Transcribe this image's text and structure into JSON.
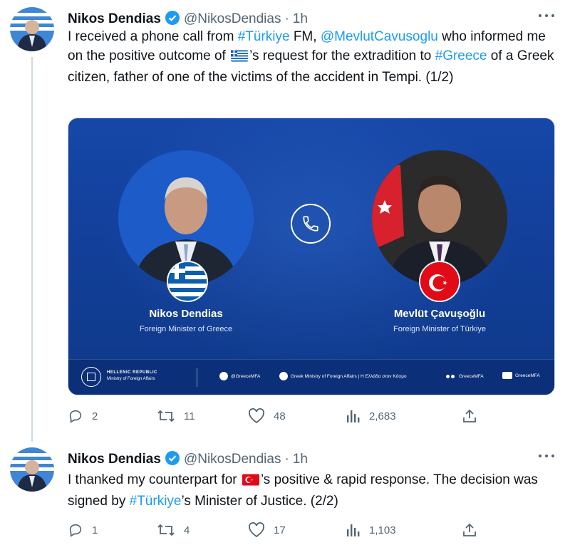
{
  "tweets": [
    {
      "author": "Nikos Dendias",
      "handle": "@NikosDendias",
      "separator": "·",
      "time": "1h",
      "text": {
        "t1": "I  received a phone call from ",
        "l1": "#Türkiye",
        "t2": " FM, ",
        "l2": "@MevlutCavusoglu",
        "t3": " who informed me on the positive outcome of ",
        "t4": "’s request for the extradition to ",
        "l3": "#Greece",
        "t5": " of a Greek citizen, father of one of the victims of the accident in Tempi. (1/2)"
      },
      "media": {
        "left_name": "Nikos Dendias",
        "left_role": "Foreign Minister of Greece",
        "right_name": "Mevlüt Çavuşoğlu",
        "right_role": "Foreign Minister of Türkiye",
        "footer_line1": "HELLENIC REPUBLIC",
        "footer_line2": "Ministry of Foreign Affairs",
        "social_twitter": "@GreeceMFA",
        "social_facebook": "Greek Ministry of Foreign Affairs | Η Ελλάδα στον Κόσμο",
        "social_flickr": "GreeceMFA",
        "social_youtube": "GreeceMFA"
      },
      "actions": {
        "replies": "2",
        "retweets": "11",
        "likes": "48",
        "views": "2,683"
      }
    },
    {
      "author": "Nikos Dendias",
      "handle": "@NikosDendias",
      "separator": "·",
      "time": "1h",
      "text": {
        "t1": "I thanked my counterpart for ",
        "t2": "’s positive & rapid response. The decision was signed by ",
        "l1": "#Türkiye",
        "t3": "’s  Minister of Justice. (2/2)"
      },
      "actions": {
        "replies": "1",
        "retweets": "4",
        "likes": "17",
        "views": "1,103"
      }
    }
  ],
  "colors": {
    "link": "#1d9bf0",
    "muted": "#536471",
    "verified": "#1d9bf0",
    "greek_blue": "#0d5eaf",
    "turkish_red": "#e30a17"
  },
  "icons": [
    "verified-badge-icon",
    "more-icon",
    "reply-icon",
    "retweet-icon",
    "like-icon",
    "views-icon",
    "share-icon",
    "phone-icon",
    "greece-flag-icon",
    "turkey-flag-icon"
  ]
}
